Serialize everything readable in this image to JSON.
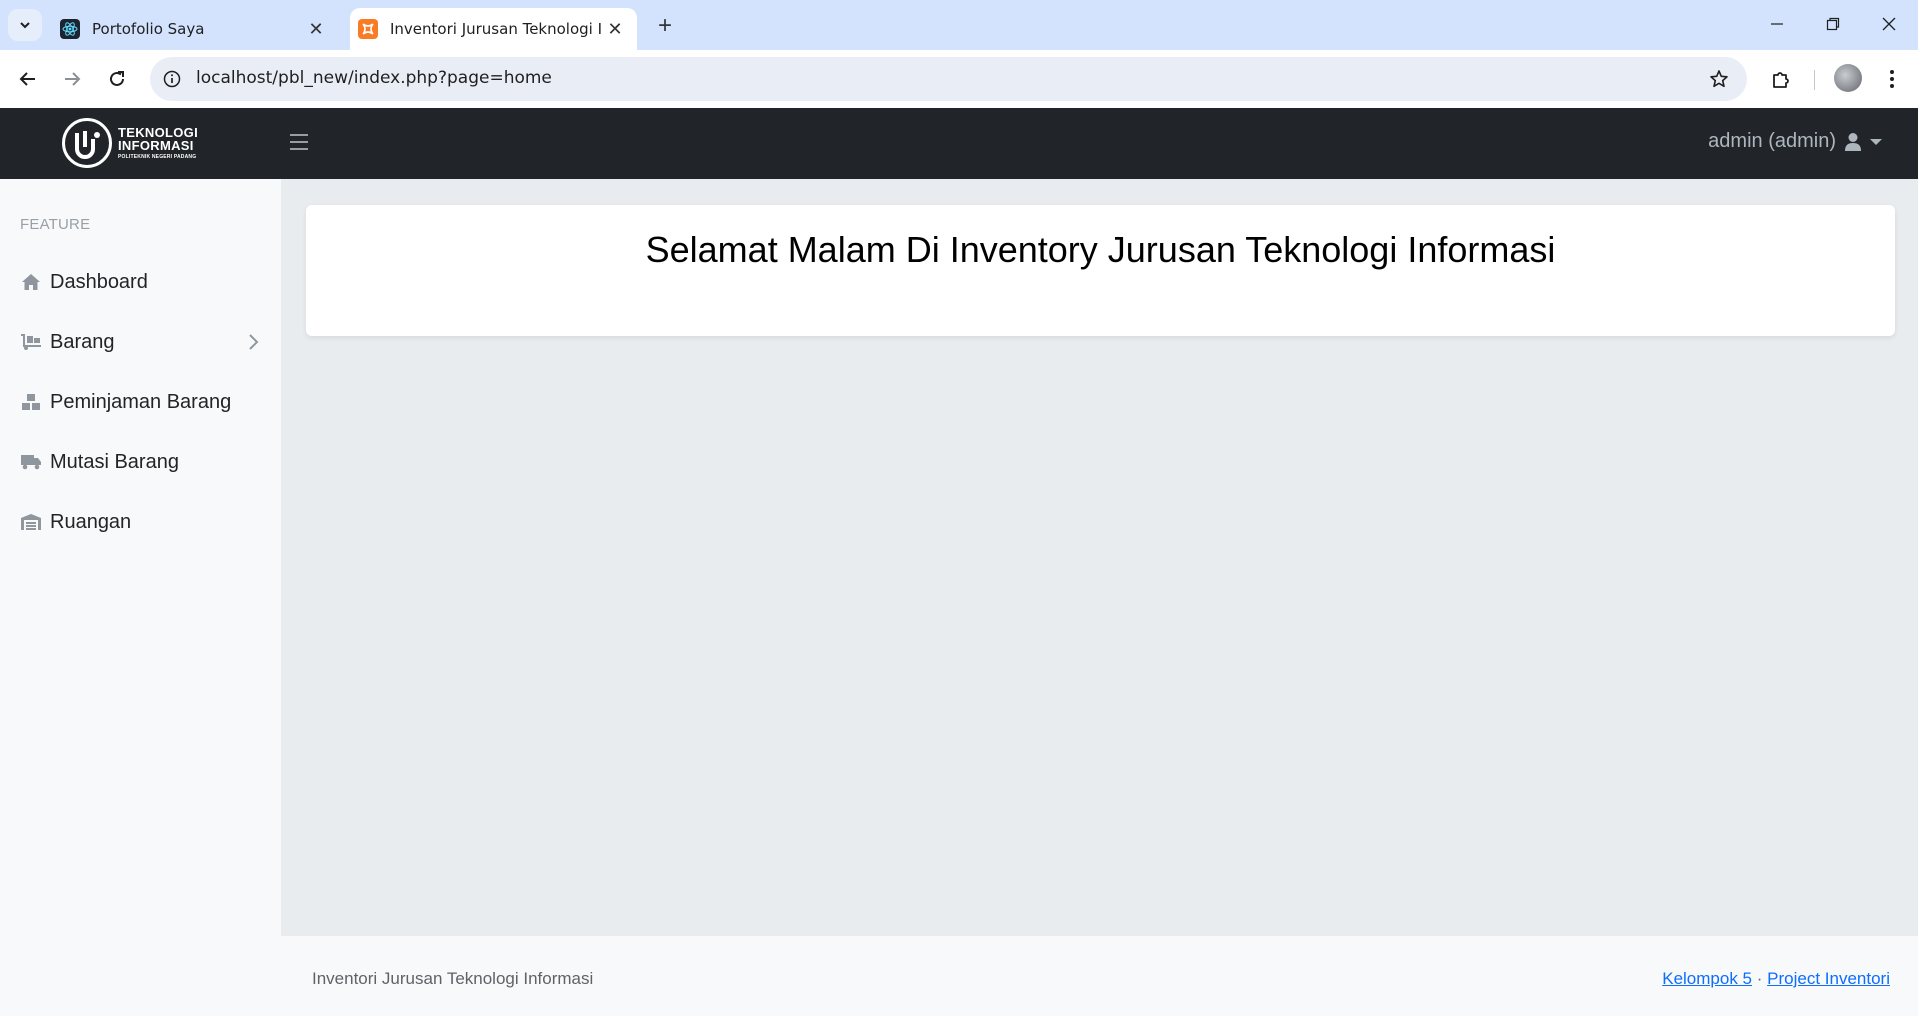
{
  "browser": {
    "tabs": [
      {
        "title": "Portofolio Saya",
        "favicon": "react-icon",
        "active": false
      },
      {
        "title": "Inventori Jurusan Teknologi Info",
        "favicon": "xampp-icon",
        "active": true
      }
    ],
    "url": "localhost/pbl_new/index.php?page=home"
  },
  "navbar": {
    "brand": {
      "line1": "TEKNOLOGI",
      "line2": "INFORMASI",
      "line3": "POLITEKNIK NEGERI PADANG"
    },
    "user_label": "admin (admin)"
  },
  "sidebar": {
    "heading": "FEATURE",
    "items": [
      {
        "label": "Dashboard",
        "icon": "home-icon"
      },
      {
        "label": "Barang",
        "icon": "dolly-icon",
        "has_submenu": true
      },
      {
        "label": "Peminjaman Barang",
        "icon": "boxes-icon"
      },
      {
        "label": "Mutasi Barang",
        "icon": "truck-icon"
      },
      {
        "label": "Ruangan",
        "icon": "warehouse-icon"
      }
    ]
  },
  "main": {
    "greeting": "Selamat Malam Di Inventory Jurusan Teknologi Informasi"
  },
  "footer": {
    "copyright": "Inventori Jurusan Teknologi Informasi",
    "link1": "Kelompok 5",
    "separator": "·",
    "link2": "Project Inventori"
  },
  "colors": {
    "navbar_bg": "#212529",
    "sidebar_bg": "#f8f9fa",
    "content_bg": "#e9ecef",
    "link": "#0d6efd"
  }
}
